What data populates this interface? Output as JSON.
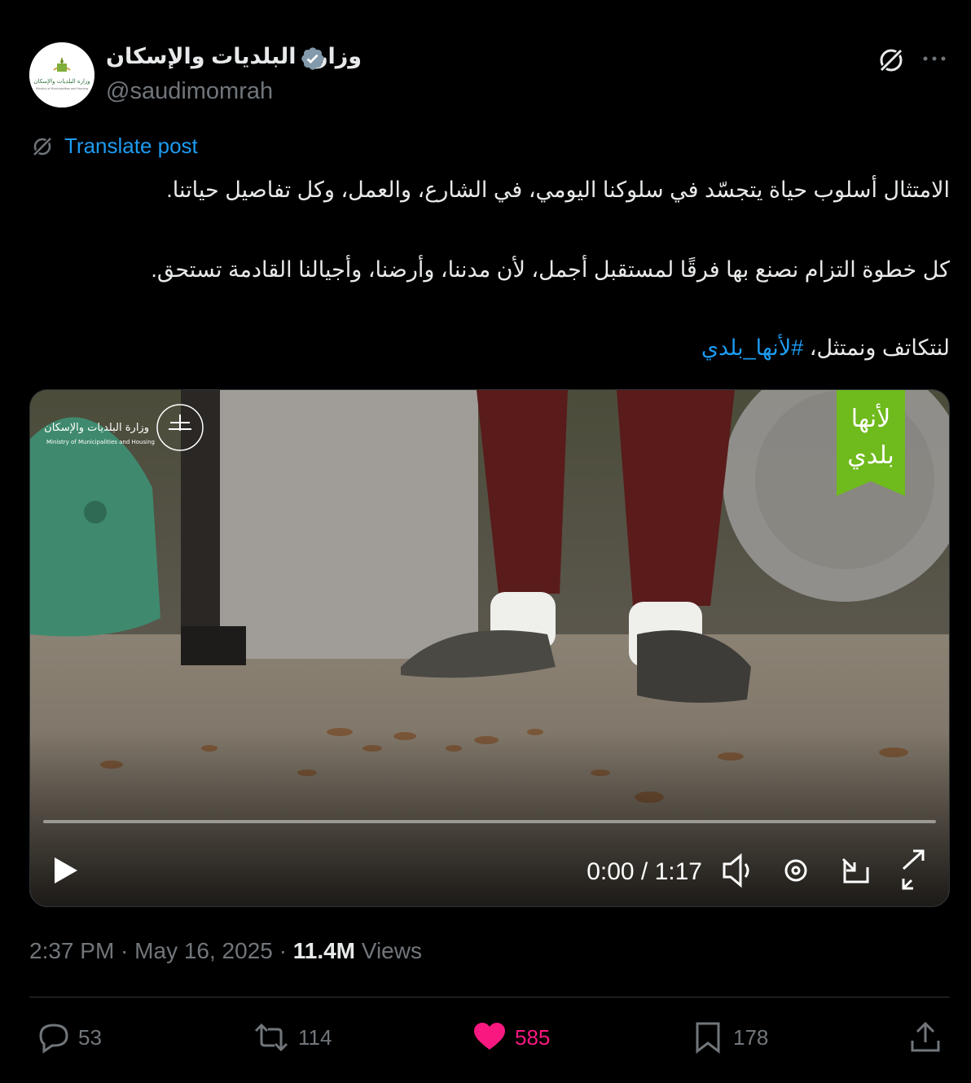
{
  "author": {
    "name": "وزارة البلديات والإسكان",
    "handle": "@saudimomrah",
    "avatar_text": "وزارة البلديات والإسكان",
    "avatar_subtext": "Ministry of Municipalities and Housing"
  },
  "translate_label": "Translate post",
  "post": {
    "line1": "الامتثال أسلوب حياة يتجسّد في سلوكنا اليومي، في الشارع، والعمل، وكل تفاصيل حياتنا.",
    "line2": "كل خطوة التزام نصنع بها فرقًا لمستقبل أجمل، لأن مدننا، وأرضنا، وأجيالنا القادمة تستحق.",
    "line3_prefix": "لنتكاتف ونمتثل، ",
    "hashtag": "#لأنها_بلدي"
  },
  "video": {
    "logo_ar": "وزارة البلديات والإسكان",
    "logo_en": "Ministry of Municipalities and Housing",
    "badge_line1": "لأنها",
    "badge_line2": "بلدي",
    "time": "0:00 / 1:17",
    "progress": 0,
    "badge_color": "#6fba1d"
  },
  "meta": {
    "time": "2:37 PM",
    "sep1": " · ",
    "date": "May 16, 2025",
    "sep2": " · ",
    "views_count": "11.4M",
    "views_label": " Views"
  },
  "actions": {
    "replies": "53",
    "reposts": "114",
    "likes": "585",
    "bookmarks": "178"
  },
  "colors": {
    "accent": "#1d9bf0",
    "like": "#f91880",
    "muted": "#71767b"
  }
}
